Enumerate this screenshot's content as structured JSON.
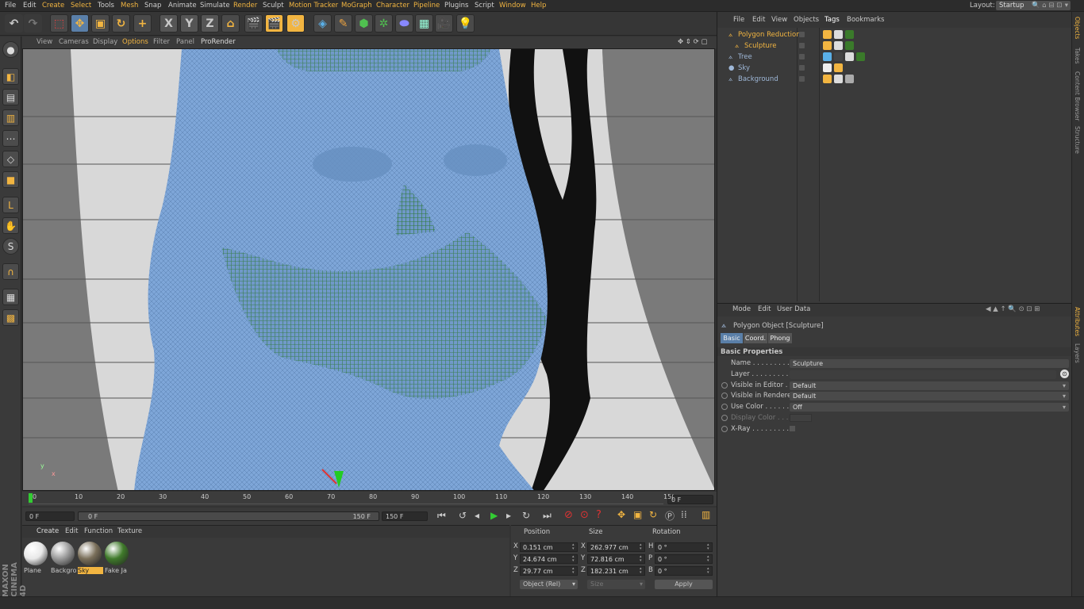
{
  "menubar": {
    "items": [
      "File",
      "Edit",
      "Create",
      "Select",
      "Tools",
      "Mesh",
      "Snap",
      "Animate",
      "Simulate",
      "Render",
      "Sculpt",
      "Motion Tracker",
      "MoGraph",
      "Character",
      "Pipeline",
      "Plugins",
      "Script",
      "Window",
      "Help"
    ],
    "highlighted": [
      "Create",
      "Select",
      "Mesh",
      "Render",
      "Motion Tracker",
      "MoGraph",
      "Character",
      "Pipeline",
      "Window",
      "Help"
    ],
    "layout_label": "Layout:",
    "layout_value": "Startup"
  },
  "toolbar": {
    "undo_icon": "undo-icon",
    "axis_x": "X",
    "axis_y": "Y",
    "axis_z": "Z"
  },
  "viewport_menu": {
    "items": [
      "View",
      "Cameras",
      "Display",
      "Options",
      "Filter",
      "Panel",
      "ProRender"
    ],
    "active": "Options"
  },
  "timeline": {
    "ticks": [
      "0",
      "10",
      "20",
      "30",
      "40",
      "50",
      "60",
      "70",
      "80",
      "90",
      "100",
      "110",
      "120",
      "130",
      "140",
      "15("
    ],
    "current_frame_field": "0 F",
    "start_field": "0 F",
    "range_start": "0 F",
    "range_end": "150 F",
    "end_field": "150 F"
  },
  "materials": {
    "menu": [
      "Create",
      "Edit",
      "Function",
      "Texture"
    ],
    "items": [
      {
        "label": "Plane",
        "color": "#e8e8e8"
      },
      {
        "label": "Backgro",
        "color": "#9a9a9a"
      },
      {
        "label": "Sky",
        "color": "#7a6f5a",
        "selected": true
      },
      {
        "label": "Fake Ja",
        "color": "#3f7a2a"
      }
    ],
    "brand": "MAXON CINEMA 4D"
  },
  "coordinates": {
    "headers": [
      "Position",
      "Size",
      "Rotation"
    ],
    "rows": [
      {
        "axis": "X",
        "pos": "0.151 cm",
        "size_axis": "X",
        "size": "262.977 cm",
        "rot_axis": "H",
        "rot": "0 °"
      },
      {
        "axis": "Y",
        "pos": "24.674 cm",
        "size_axis": "Y",
        "size": "72.816 cm",
        "rot_axis": "P",
        "rot": "0 °"
      },
      {
        "axis": "Z",
        "pos": "29.77 cm",
        "size_axis": "Z",
        "size": "182.231 cm",
        "rot_axis": "B",
        "rot": "0 °"
      }
    ],
    "mode": "Object (Rel)",
    "size_mode": "Size",
    "apply_label": "Apply"
  },
  "objects": {
    "menu": [
      "File",
      "Edit",
      "View",
      "Objects",
      "Tags",
      "Bookmarks"
    ],
    "active_menu": "Tags",
    "rows": [
      {
        "name": "Polygon Reduction",
        "color": "#f2b541",
        "indent": 0
      },
      {
        "name": "Sculpture",
        "color": "#f2b541",
        "indent": 1
      },
      {
        "name": "Tree",
        "color": "#9fb8d8",
        "indent": 0
      },
      {
        "name": "Sky",
        "color": "#9fb8d8",
        "indent": 0
      },
      {
        "name": "Background",
        "color": "#9fb8d8",
        "indent": 0
      }
    ]
  },
  "attributes": {
    "menu": [
      "Mode",
      "Edit",
      "User Data"
    ],
    "object_title": "Polygon Object [Sculpture]",
    "tabs": [
      "Basic",
      "Coord.",
      "Phong"
    ],
    "active_tab": "Basic",
    "section": "Basic Properties",
    "props": [
      {
        "label": "Name . . . . . . . . . .",
        "value": "Sculpture",
        "dd": false
      },
      {
        "label": "Layer . . . . . . . . . .",
        "value": "",
        "dd": false
      },
      {
        "label": "Visible in Editor . .",
        "value": "Default",
        "dd": true
      },
      {
        "label": "Visible in Renderer",
        "value": "Default",
        "dd": true
      },
      {
        "label": "Use Color . . . . . .",
        "value": "Off",
        "dd": true
      },
      {
        "label": "Display Color . . .",
        "value": "",
        "dd": false
      },
      {
        "label": "X-Ray . . . . . . . . .",
        "value": "",
        "dd": false
      }
    ]
  },
  "right_tabs": {
    "top": [
      "Objects",
      "Takes",
      "Content Browser",
      "Structure"
    ],
    "bottom": [
      "Attributes",
      "Layers"
    ]
  }
}
